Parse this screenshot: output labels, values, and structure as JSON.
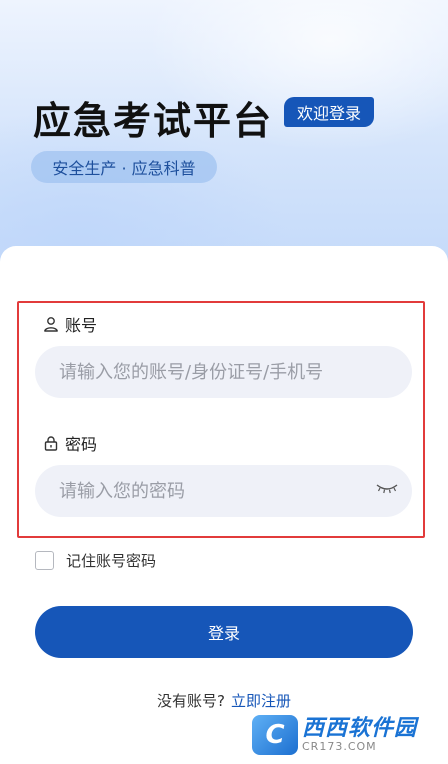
{
  "header": {
    "title": "应急考试平台",
    "welcome_badge": "欢迎登录",
    "subtitle": "安全生产 · 应急科普"
  },
  "form": {
    "account": {
      "label": "账号",
      "icon": "user-icon",
      "value": "",
      "placeholder": "请输入您的账号/身份证号/手机号"
    },
    "password": {
      "label": "密码",
      "icon": "lock-icon",
      "value": "",
      "placeholder": "请输入您的密码",
      "toggle_icon": "eye-closed-icon"
    },
    "remember": {
      "label": "记住账号密码",
      "checked": false
    },
    "login_button": "登录"
  },
  "footer": {
    "no_account_prompt": "没有账号?",
    "register_link": "立即注册"
  },
  "watermark": {
    "logo_glyph": "C",
    "brand": "西西软件园",
    "domain": "CR173.COM"
  },
  "colors": {
    "primary": "#1656b8",
    "highlight_border": "#e23b3b",
    "input_bg": "#eff1f8"
  }
}
